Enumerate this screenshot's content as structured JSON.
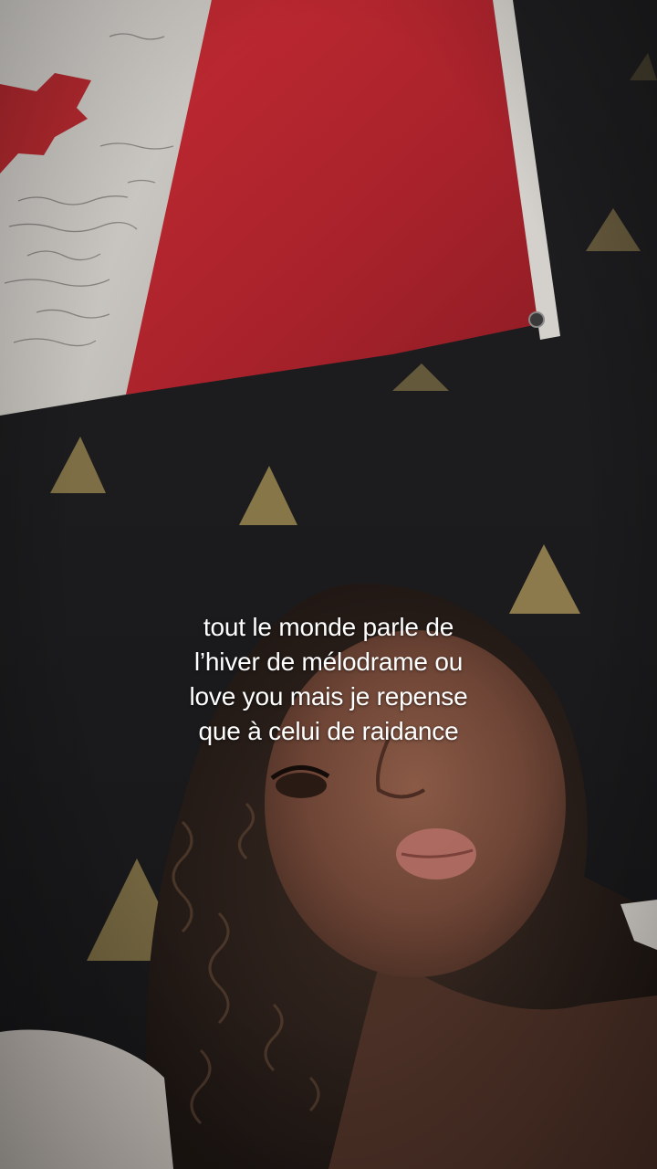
{
  "caption": {
    "lines": [
      "tout le monde parle de",
      "l’hiver de mélodrame ou",
      "love you mais je repense",
      "que à celui de raidance"
    ]
  },
  "scene": {
    "subject": "selfie-video-frame",
    "background_icon": "canada-flag-icon",
    "wall_pattern_icon": "gold-triangle-icon"
  },
  "colors": {
    "flag_red": "#b3262e",
    "flag_white": "#d9d6d2",
    "wall": "#1c1c1e",
    "triangle_gold": "#a8945a",
    "caption_text": "#ffffff"
  }
}
